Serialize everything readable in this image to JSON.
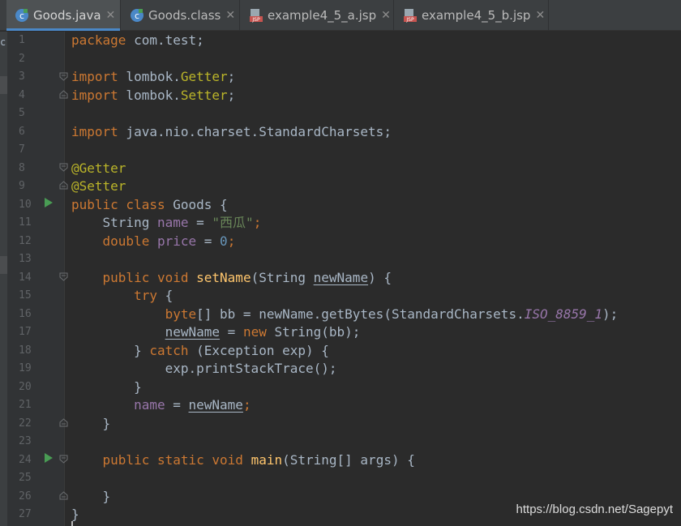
{
  "tabs": [
    {
      "label": "Goods.java",
      "close": "✕",
      "icon": "java-class-icon",
      "active": true
    },
    {
      "label": "Goods.class",
      "close": "✕",
      "icon": "java-class-icon",
      "active": false
    },
    {
      "label": "example4_5_a.jsp",
      "close": "✕",
      "icon": "jsp-file-icon",
      "active": false
    },
    {
      "label": "example4_5_b.jsp",
      "close": "✕",
      "icon": "jsp-file-icon",
      "active": false
    }
  ],
  "left_strip_text": "c",
  "line_numbers": [
    "1",
    "2",
    "3",
    "4",
    "5",
    "6",
    "7",
    "8",
    "9",
    "10",
    "11",
    "12",
    "13",
    "14",
    "15",
    "16",
    "17",
    "18",
    "19",
    "20",
    "21",
    "22",
    "23",
    "24",
    "25",
    "26",
    "27"
  ],
  "code": {
    "l1": {
      "kw": "package",
      "rest": " com.test;"
    },
    "l3": {
      "kw": "import",
      "a": " lombok.",
      "an": "Getter",
      "b": ";"
    },
    "l4": {
      "kw": "import",
      "a": " lombok.",
      "an": "Setter",
      "b": ";"
    },
    "l6": {
      "kw": "import",
      "a": " java.nio.charset.StandardCharsets;"
    },
    "l8": {
      "an": "@Getter"
    },
    "l9": {
      "an": "@Setter"
    },
    "l10": {
      "kw": "public class",
      "a": " Goods {"
    },
    "l11": {
      "a": "    String ",
      "fld": "name",
      "b": " = ",
      "st": "\"西瓜\"",
      "c": ";"
    },
    "l12": {
      "kw": "    double",
      "a": " ",
      "fld": "price",
      "b": " = ",
      "nm": "0",
      "c": ";"
    },
    "l14": {
      "kw": "    public void",
      "a": " ",
      "fn": "setName",
      "b": "(String ",
      "ul": "newName",
      "c": ") {"
    },
    "l15": {
      "kw": "        try",
      "a": " {"
    },
    "l16": {
      "kw": "            byte",
      "a": "[] bb = newName.getBytes(StandardCharsets.",
      "it": "ISO_8859_1",
      "b": ");"
    },
    "l17": {
      "pre": "            ",
      "ul": "newName",
      "a": " = ",
      "kw": "new",
      "b": " String(bb);"
    },
    "l18": {
      "a": "        } ",
      "kw": "catch",
      "b": " (Exception exp) {"
    },
    "l19": {
      "a": "            exp.printStackTrace();"
    },
    "l20": {
      "a": "        }"
    },
    "l21": {
      "pre": "        ",
      "fld": "name",
      "a": " = ",
      "ul": "newName",
      "b": ";"
    },
    "l22": {
      "a": "    }"
    },
    "l24": {
      "kw": "    public static void",
      "a": " ",
      "fn": "main",
      "b": "(String[] args) {"
    },
    "l26": {
      "a": "    }"
    },
    "l27": {
      "a": "}"
    }
  },
  "watermark": "https://blog.csdn.net/Sagepyt",
  "colors": {
    "keyword": "#cc7832",
    "annotation": "#bbb529",
    "method": "#ffc66d",
    "field": "#9876aa",
    "string": "#6a8759",
    "number": "#6897bb",
    "text": "#a9b7c6",
    "accent": "#4a88c7"
  }
}
